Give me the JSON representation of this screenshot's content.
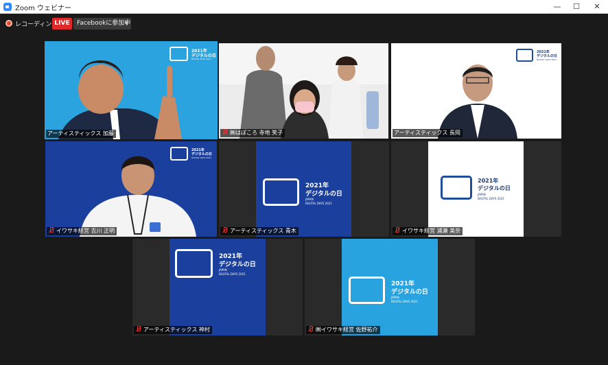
{
  "window": {
    "title": "Zoom ウェビナー"
  },
  "toolbar": {
    "recording_label": "レコーディング中",
    "live_label": "LIVE",
    "facebook_label": "Facebookに参加中"
  },
  "logo": {
    "year": "2021年",
    "title": "デジタルの日",
    "sub1": "JAPAN",
    "sub2": "DIGITAL DAYS 2021"
  },
  "participants": [
    {
      "name": "アーティスティックス 加藤",
      "muted": false,
      "active": true,
      "video": true
    },
    {
      "name": "㈱はぽころ 寺地 笑子",
      "muted": true,
      "active": false,
      "video": true
    },
    {
      "name": "アーティスティックス 長岡",
      "muted": false,
      "active": false,
      "video": true
    },
    {
      "name": "イワサキ経営 吉川 正明",
      "muted": true,
      "active": false,
      "video": true
    },
    {
      "name": "アーティスティックス 青木",
      "muted": true,
      "active": false,
      "video": false
    },
    {
      "name": "イワサキ経営 浦瀬 美奈",
      "muted": true,
      "active": false,
      "video": false
    },
    {
      "name": "アーティスティックス 神村",
      "muted": true,
      "active": false,
      "video": false
    },
    {
      "name": "㈱イワサキ経営 佐野祐介",
      "muted": true,
      "active": false,
      "video": false
    }
  ],
  "colors": {
    "active_border": "#e5f24a",
    "live": "#e02828",
    "logo_blue": "#1a3f9c",
    "logo_cyan": "#29a3df"
  }
}
